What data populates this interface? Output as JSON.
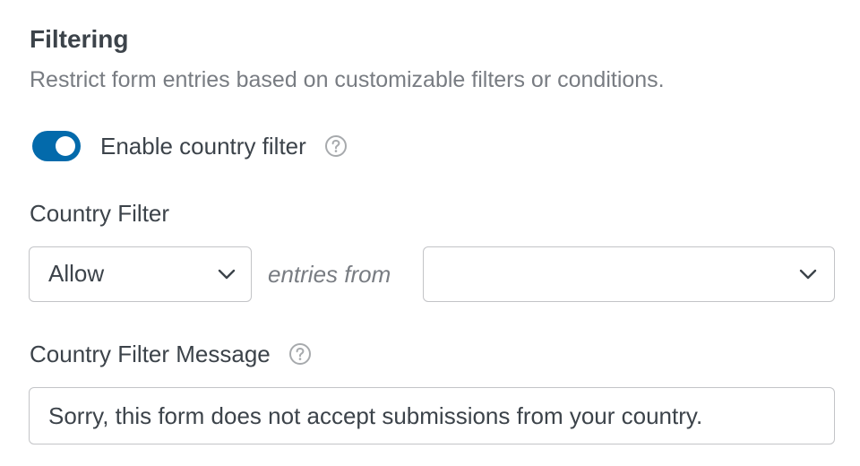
{
  "section": {
    "title": "Filtering",
    "description": "Restrict form entries based on customizable filters or conditions."
  },
  "country_filter_toggle": {
    "label": "Enable country filter",
    "enabled": true,
    "help_icon": "question-circle-icon"
  },
  "country_filter": {
    "label": "Country Filter",
    "mode_select": {
      "value": "Allow",
      "icon": "chevron-down-icon"
    },
    "connector_text": "entries from",
    "countries_select": {
      "value": "",
      "icon": "chevron-down-icon"
    }
  },
  "message": {
    "label": "Country Filter Message",
    "help_icon": "question-circle-icon",
    "value": "Sorry, this form does not accept submissions from your country."
  },
  "colors": {
    "accent": "#036aab",
    "text": "#3c434a",
    "muted_text": "#787c82",
    "border": "#c3c4c7"
  }
}
